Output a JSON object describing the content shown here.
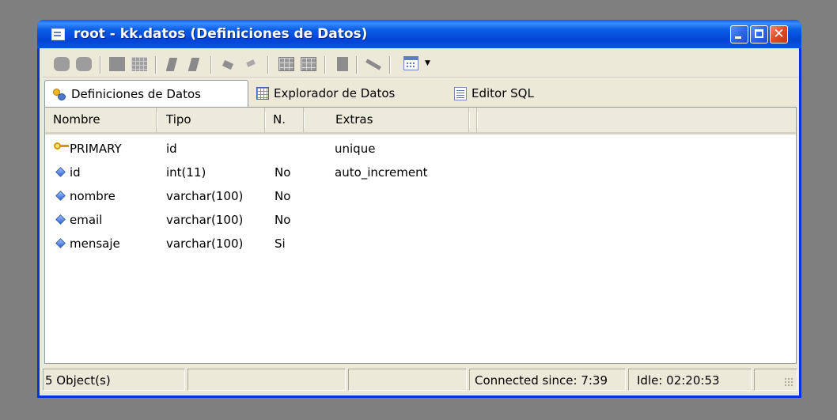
{
  "window": {
    "title": "root - kk.datos  (Definiciones de Datos)",
    "controls": [
      "minimize",
      "maximize",
      "close"
    ]
  },
  "toolbar": {
    "icons": [
      "database-icon",
      "database-alt-icon",
      "table-icon",
      "table-grid-icon",
      "key-icon",
      "key-alt-icon",
      "arrow-right-icon",
      "arrow-left-icon",
      "grid-icon",
      "grid-alt-icon",
      "document-icon",
      "pen-icon",
      "calendar-icon"
    ]
  },
  "tabs": [
    {
      "label": "Definiciones de Datos",
      "icon": "keys-icon",
      "active": true
    },
    {
      "label": "Explorador de Datos",
      "icon": "grid-icon",
      "active": false
    },
    {
      "label": "Editor SQL",
      "icon": "sql-document-icon",
      "active": false
    }
  ],
  "table": {
    "columns": [
      "Nombre",
      "Tipo",
      "N.",
      "Extras"
    ],
    "rows": [
      {
        "icon": "primary-key-icon",
        "nombre": "PRIMARY",
        "tipo": "id",
        "n": "",
        "extras": "unique"
      },
      {
        "icon": "field-icon",
        "nombre": "id",
        "tipo": "int(11)",
        "n": "No",
        "extras": "auto_increment"
      },
      {
        "icon": "field-icon",
        "nombre": "nombre",
        "tipo": "varchar(100)",
        "n": "No",
        "extras": ""
      },
      {
        "icon": "field-icon",
        "nombre": "email",
        "tipo": "varchar(100)",
        "n": "No",
        "extras": ""
      },
      {
        "icon": "field-icon",
        "nombre": "mensaje",
        "tipo": "varchar(100)",
        "n": "Si",
        "extras": ""
      }
    ]
  },
  "status": {
    "objects": "5 Object(s)",
    "connected": "Connected since: 7:39",
    "idle": "Idle: 02:20:53"
  }
}
